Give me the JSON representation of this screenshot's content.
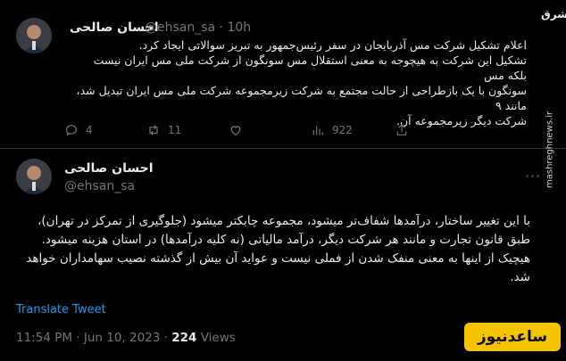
{
  "tweet1": {
    "name": "احسان صالحی",
    "handle": "@ehsan_sa · 10h",
    "lines": [
      "اعلام تشکیل شرکت مس آذربایجان در سفر رئیس‌جمهور به تبریز سوالاتی ایجاد کرد.",
      "تشکیل این شرکت به هیچوجه به معنی استقلال مس سونگون از شرکت ملی مس ایران نیست بلکه مس",
      "سونگون با یک بازطراحی از حالت مجتمع به شرکت زیرمجموعه شرکت ملی مس ایران تبدیل شد، مانند ۹",
      "شرکت دیگر زیرمجموعه آن."
    ],
    "replies": "4",
    "retweets": "11",
    "likes": "",
    "views": "922"
  },
  "tweet2": {
    "name": "احسان صالحی",
    "handle": "@ehsan_sa",
    "more": "···",
    "lines": [
      "با این تغییر ساختار، درآمدها شفاف‌تر میشود، مجموعه چابکتر  میشود (جلوگیری از تمرکز در تهران)،",
      "طبق قانون تجارت و مانند هر شرکت دیگر، درآمد مالیاتی (نه کلیه درآمدها) در استان هزینه میشود.",
      "هیچیک از اینها به معنی منفک شدن از فملی نیست و عواید آن بیش از گذشته نصیب سهامداران خواهد",
      "شد."
    ],
    "translate": "Translate Tweet",
    "time": "11:54 PM · Jun 10, 2023 · ",
    "views_count": "224",
    "views_label": " Views"
  },
  "watermarks": {
    "logo": "مشرق",
    "url": "mashreghnews.ir",
    "badge": "ساعدنیوز"
  },
  "colors": {
    "background": "#000000",
    "text": "#e7e9ea",
    "muted": "#71767b",
    "link": "#1d9bf0",
    "badge": "#f4c400"
  }
}
